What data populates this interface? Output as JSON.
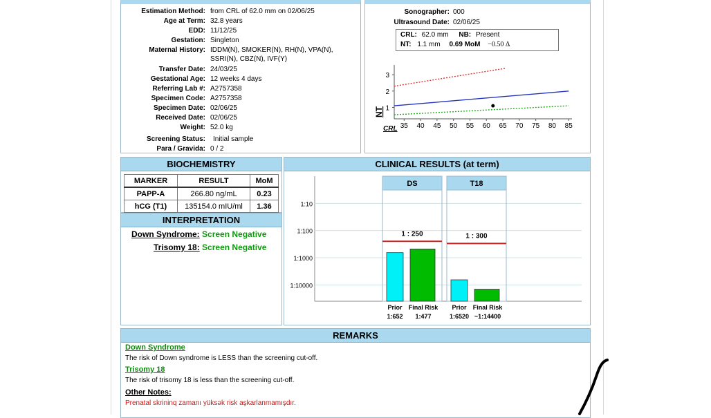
{
  "patient": {
    "fields": [
      {
        "label": "Estimation Method:",
        "value": "from CRL of 62.0 mm on 02/06/25"
      },
      {
        "label": "Age at Term:",
        "value": "32.8 years"
      },
      {
        "label": "EDD:",
        "value": "11/12/25"
      },
      {
        "label": "Gestation:",
        "value": "Singleton"
      },
      {
        "label": "Maternal History:",
        "value": "IDDM(N), SMOKER(N), RH(N), VPA(N),",
        "value2": "SSRI(N), CBZ(N), IVF(Y)"
      },
      {
        "label": "Transfer Date:",
        "value": "24/03/25"
      },
      {
        "label": "Gestational Age:",
        "value": "12 weeks 4 days"
      },
      {
        "label": "Referring Lab #:",
        "value": "A2757358"
      },
      {
        "label": "Specimen Code:",
        "value": "A2757358"
      },
      {
        "label": "Specimen Date:",
        "value": "02/06/25"
      },
      {
        "label": "Received Date:",
        "value": "02/06/25"
      },
      {
        "label": "Weight:",
        "value": "52.0 kg"
      },
      {
        "label": "Screening Status:",
        "value": "Initial sample"
      },
      {
        "label": "Para / Gravida:",
        "value": "0 / 2"
      }
    ]
  },
  "ultrasound": {
    "sonographer_label": "Sonographer:",
    "sonographer": "000",
    "date_label": "Ultrasound Date:",
    "date": "02/06/25",
    "crl_label": "CRL:",
    "crl": "62.0 mm",
    "nb_label": "NB:",
    "nb": "Present",
    "nt_label": "NT:",
    "nt": "1.1 mm",
    "nt_mom": "0.69 MoM",
    "nt_delta": "−0.50 Δ",
    "chart_y_label": "NT",
    "chart_x_label": "CRL"
  },
  "biochemistry": {
    "title": "BIOCHEMISTRY",
    "headers": [
      "MARKER",
      "RESULT",
      "MoM"
    ],
    "rows": [
      {
        "marker": "PAPP-A",
        "result": "266.80 ng/mL",
        "mom": "0.23"
      },
      {
        "marker": "hCG (T1)",
        "result": "135154.0 mIU/ml",
        "mom": "1.36"
      }
    ]
  },
  "interpretation": {
    "title": "INTERPRETATION",
    "ds_label": "Down Syndrome:",
    "ds_value": "Screen Negative",
    "t18_label": "Trisomy 18:",
    "t18_value": "Screen Negative"
  },
  "clinical": {
    "title": "CLINICAL RESULTS (at term)",
    "y_ticks": [
      "1:10",
      "1:100",
      "1:1000",
      "1:10000"
    ],
    "groups": [
      {
        "name": "DS",
        "cutoff": "1 : 250",
        "prior_label": "Prior",
        "final_label": "Final Risk",
        "prior_value": "1:652",
        "final_value": "1:477"
      },
      {
        "name": "T18",
        "cutoff": "1 : 300",
        "prior_label": "Prior",
        "final_label": "Final Risk",
        "prior_value": "1:6520",
        "final_value": "~1:14400"
      }
    ]
  },
  "chart_data": [
    {
      "type": "line",
      "xlabel": "CRL",
      "ylabel": "NT",
      "x_ticks": [
        35,
        40,
        45,
        50,
        55,
        60,
        65,
        70,
        75,
        80,
        85
      ],
      "y_ticks": [
        1,
        2,
        3
      ],
      "xlim": [
        32,
        86
      ],
      "ylim": [
        0.3,
        3.6
      ],
      "series": [
        {
          "x": [
            32,
            66
          ],
          "y": [
            2.3,
            3.4
          ],
          "color": "#dd3333",
          "dash": true
        },
        {
          "x": [
            32,
            85
          ],
          "y": [
            1.1,
            2.0
          ],
          "color": "#2233bb",
          "dash": false
        },
        {
          "x": [
            32,
            85
          ],
          "y": [
            0.55,
            1.1
          ],
          "color": "#22aa22",
          "dash": true
        }
      ],
      "points": [
        {
          "x": 62,
          "y": 1.1
        }
      ]
    },
    {
      "type": "bar",
      "title": "CLINICAL RESULTS (at term)",
      "y_scale": "log-reciprocal",
      "ylim": [
        1,
        40000
      ],
      "categories": [
        "DS Prior",
        "DS Final Risk",
        "T18 Prior",
        "T18 Final Risk"
      ],
      "values": [
        652,
        477,
        6520,
        14400
      ],
      "bar_colors": [
        "#00f0f8",
        "#00bb00",
        "#00f0f8",
        "#00bb00"
      ],
      "cutoffs": [
        250,
        300
      ],
      "cutoff_color": "#cc2222"
    }
  ],
  "remarks": {
    "title": "REMARKS",
    "ds_title": "Down Syndrome",
    "ds_text": "The risk of Down syndrome is LESS than the screening cut-off.",
    "t18_title": "Trisomy 18",
    "t18_text": "The risk of trisomy 18 is less than the screening cut-off.",
    "other_title": "Other Notes:",
    "other_text": "Prenatal skrininq zamanı yüksək risk aşkarlanmamışdır.",
    "other_color": "#cc1111"
  }
}
